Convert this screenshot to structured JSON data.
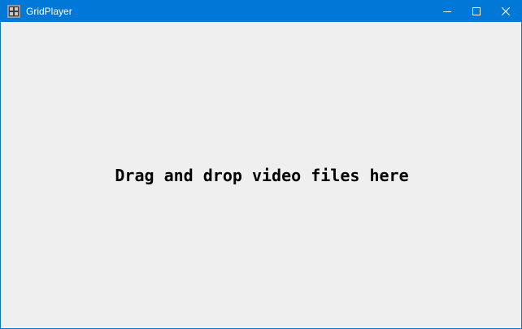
{
  "window": {
    "title": "GridPlayer",
    "title_bar_color": "#0078d7",
    "background_color": "#f0eff0"
  },
  "titlebar": {
    "app_icon": "grid-film-icon",
    "buttons": {
      "minimize": "minimize-icon",
      "maximize": "maximize-icon",
      "close": "close-icon"
    }
  },
  "content": {
    "drop_hint": "Drag and drop video files here"
  }
}
